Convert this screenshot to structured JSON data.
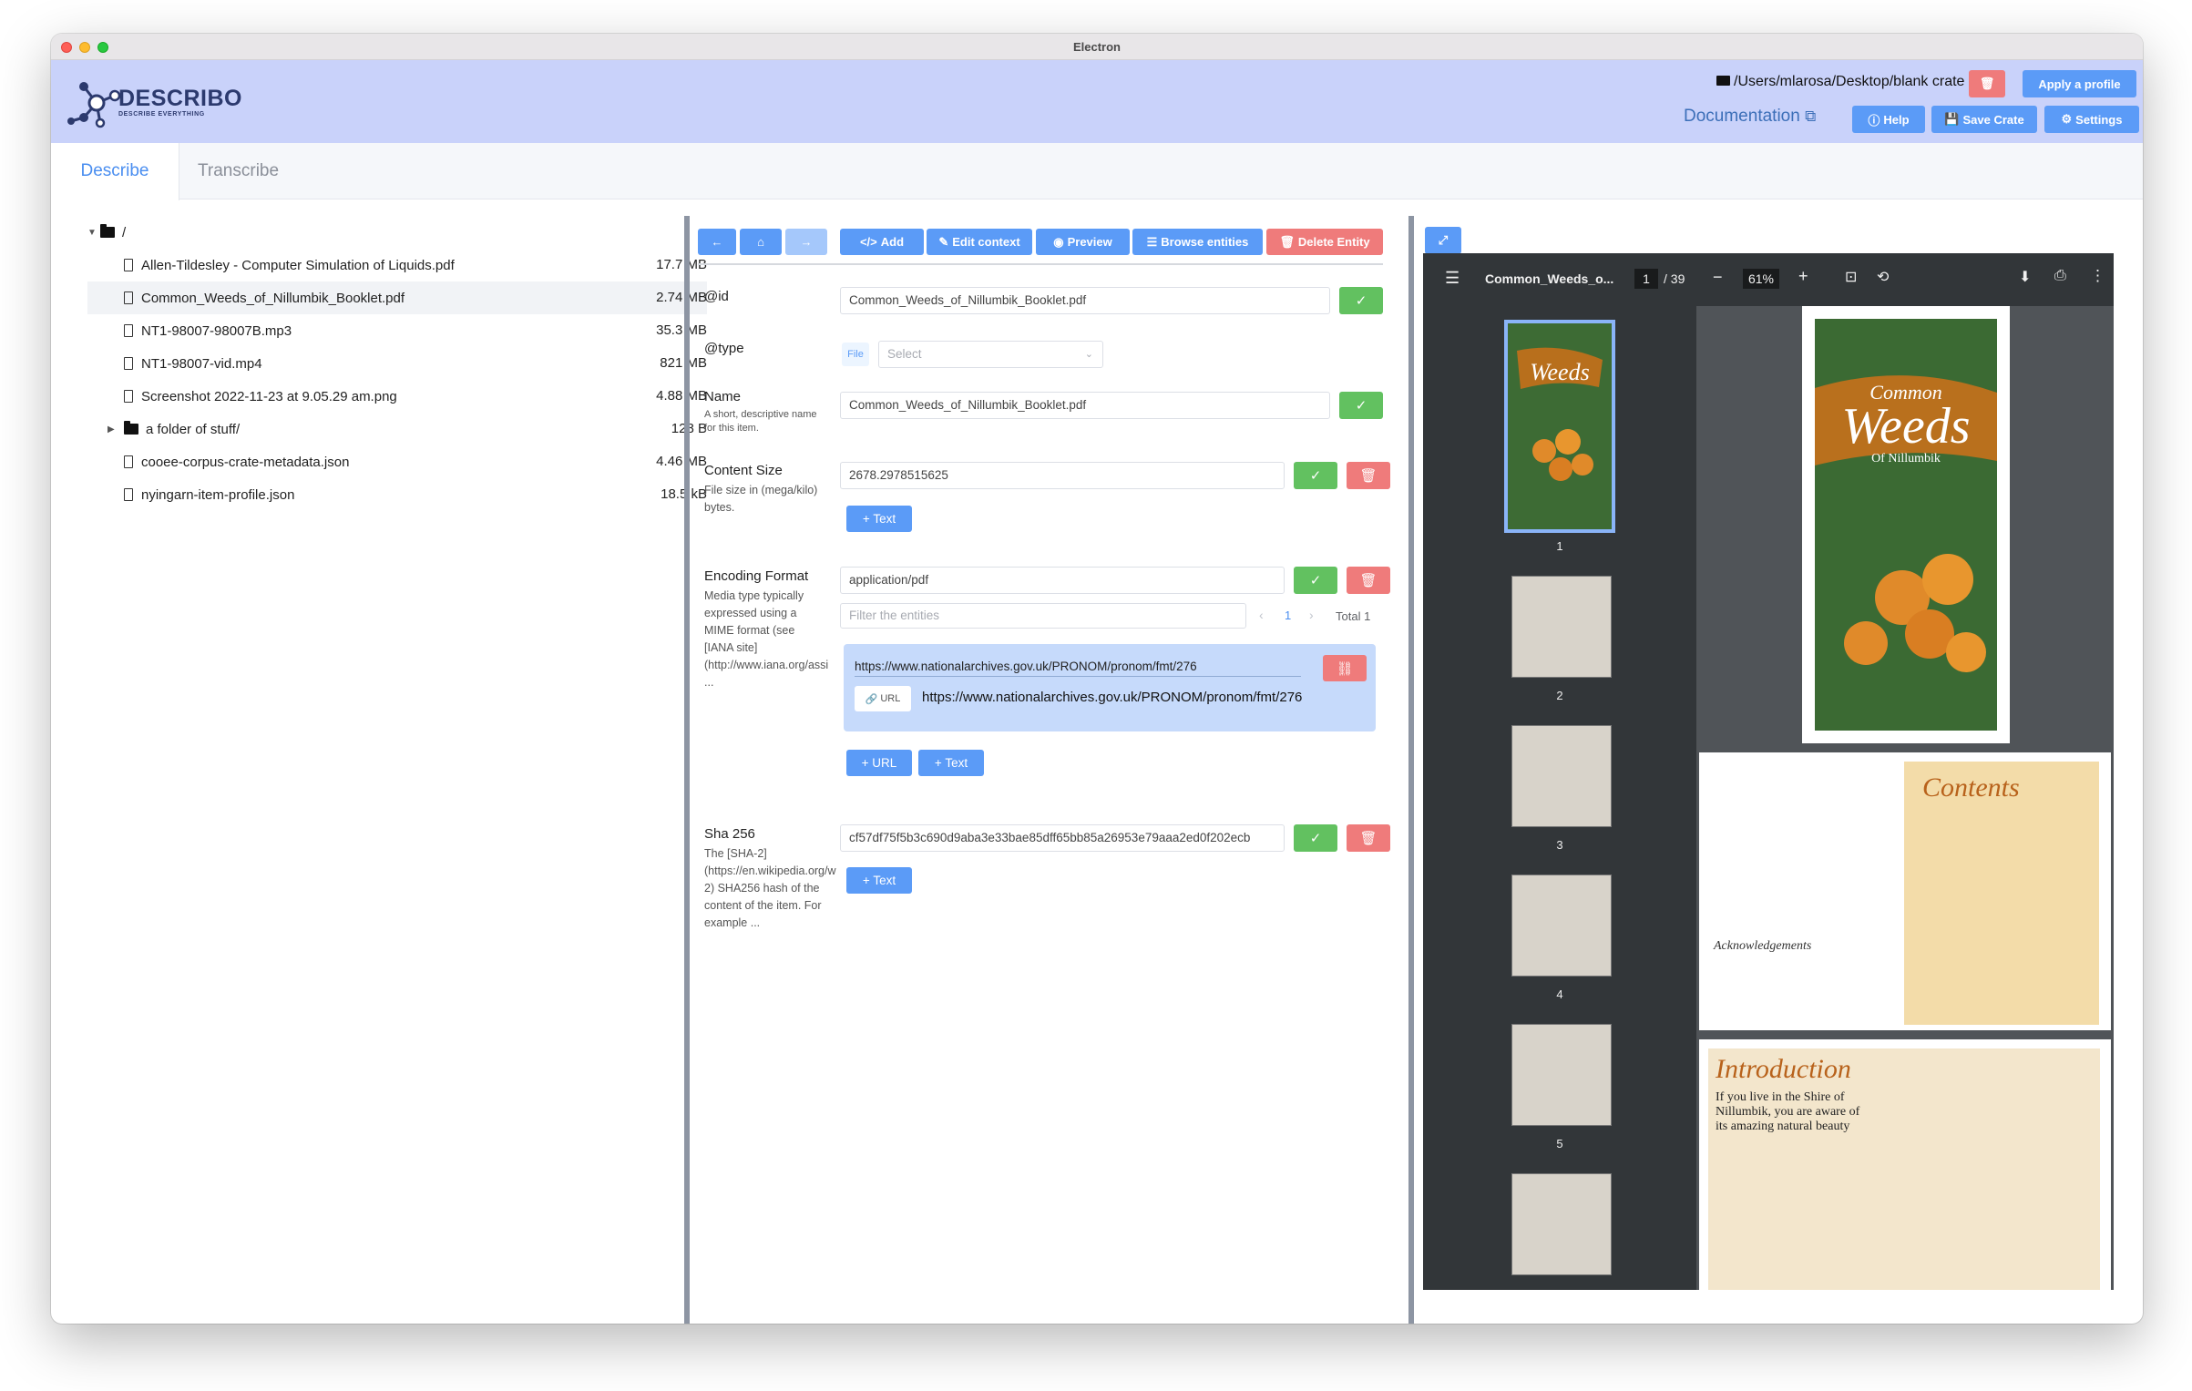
{
  "window": {
    "title": "Electron"
  },
  "header": {
    "logo_text": "DESCRIBO",
    "logo_sub": "DESCRIBE EVERYTHING",
    "path": "/Users/mlarosa/Desktop/blank crate",
    "apply_profile": "Apply a profile",
    "documentation": "Documentation",
    "help": "Help",
    "save_crate": "Save Crate",
    "settings": "Settings"
  },
  "tabs": {
    "describe": "Describe",
    "transcribe": "Transcribe"
  },
  "tree": {
    "root": "/",
    "items": [
      {
        "name": "Allen-Tildesley - Computer Simulation of Liquids.pdf",
        "size": "17.7 MB",
        "kind": "file"
      },
      {
        "name": "Common_Weeds_of_Nillumbik_Booklet.pdf",
        "size": "2.74 MB",
        "kind": "file",
        "selected": true
      },
      {
        "name": "NT1-98007-98007B.mp3",
        "size": "35.3 MB",
        "kind": "file"
      },
      {
        "name": "NT1-98007-vid.mp4",
        "size": "821 MB",
        "kind": "file"
      },
      {
        "name": "Screenshot 2022-11-23 at 9.05.29 am.png",
        "size": "4.88 MB",
        "kind": "file"
      },
      {
        "name": "a folder of stuff/",
        "size": "128 B",
        "kind": "folder"
      },
      {
        "name": "cooee-corpus-crate-metadata.json",
        "size": "4.46 MB",
        "kind": "file"
      },
      {
        "name": "nyingarn-item-profile.json",
        "size": "18.5 kB",
        "kind": "file"
      }
    ]
  },
  "toolbar": {
    "add": "Add",
    "edit_context": "Edit context",
    "preview": "Preview",
    "browse_entities": "Browse entities",
    "delete_entity": "Delete Entity"
  },
  "fields": {
    "id": {
      "label": "@id",
      "value": "Common_Weeds_of_Nillumbik_Booklet.pdf"
    },
    "type": {
      "label": "@type",
      "tag": "File",
      "select_placeholder": "Select"
    },
    "name": {
      "label": "Name",
      "help1": "A short, descriptive name",
      "help2": "for this item.",
      "value": "Common_Weeds_of_Nillumbik_Booklet.pdf"
    },
    "content_size": {
      "label": "Content Size",
      "help1": "File size in (mega/kilo)",
      "help2": "bytes.",
      "value": "2678.2978515625",
      "add_text": "+ Text"
    },
    "encoding_format": {
      "label": "Encoding Format",
      "help1": "Media type typically",
      "help2": "expressed using a",
      "help3": "MIME format (see",
      "help4": "[IANA site]",
      "help5": "(http://www.iana.org/assi",
      "help6": "...",
      "value": "application/pdf",
      "filter_placeholder": "Filter the entities",
      "page": "1",
      "total": "Total 1",
      "entity_name": "https://www.nationalarchives.gov.uk/PRONOM/pronom/fmt/276",
      "entity_tag": "URL",
      "entity_url": "https://www.nationalarchives.gov.uk/PRONOM/pronom/fmt/276",
      "add_url": "+ URL",
      "add_text": "+ Text"
    },
    "sha256": {
      "label": "Sha 256",
      "help1": "The [SHA-2]",
      "help2": "(https://en.wikipedia.org/w",
      "help3": "2) SHA256 hash of the",
      "help4": "content of the item. For",
      "help5": "example ...",
      "value": "cf57df75f5b3c690d9aba3e33bae85dff65bb85a26953e79aaa2ed0f202ecb",
      "add_text": "+ Text"
    }
  },
  "viewer": {
    "filename": "Common_Weeds_o...",
    "page": "1",
    "page_total": "/ 39",
    "zoom": "61%",
    "thumb_numbers": [
      "1",
      "2",
      "3",
      "4",
      "5"
    ],
    "cover_title1": "Common",
    "cover_title2": "Weeds",
    "cover_title3": "Of Nillumbik",
    "contents_title": "Contents",
    "ack_title": "Acknowledgements",
    "intro_title": "Introduction",
    "intro_text1": "If you live in the Shire of",
    "intro_text2": "Nillumbik, you are aware of",
    "intro_text3": "its amazing natural beauty"
  }
}
